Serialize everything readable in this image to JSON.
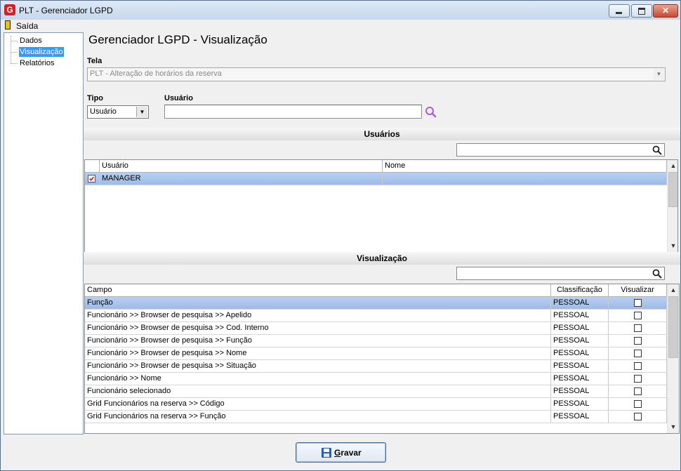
{
  "window": {
    "title": "PLT - Gerenciador LGPD",
    "app_icon_letter": "G",
    "close_symbol": "✕"
  },
  "menu": {
    "exit_label": "Saída"
  },
  "tree": {
    "items": [
      {
        "label": "Dados",
        "selected": false
      },
      {
        "label": "Visualização",
        "selected": true
      },
      {
        "label": "Relatórios",
        "selected": false
      }
    ]
  },
  "page": {
    "title": "Gerenciador LGPD - Visualização",
    "tela_label": "Tela",
    "tela_value": "PLT - Alteração de horários da reserva",
    "tipo_label": "Tipo",
    "tipo_value": "Usuário",
    "usuario_label": "Usuário",
    "usuario_value": ""
  },
  "users_section": {
    "title": "Usuários",
    "filter_value": "",
    "columns": [
      "Usuário",
      "Nome"
    ],
    "rows": [
      {
        "checked": true,
        "usuario": "MANAGER",
        "nome": ""
      }
    ]
  },
  "view_section": {
    "title": "Visualização",
    "filter_value": "",
    "columns": [
      "Campo",
      "Classificação",
      "Visualizar"
    ],
    "rows": [
      {
        "campo": "Função",
        "classificacao": "PESSOAL",
        "visualizar": false
      },
      {
        "campo": "Funcionário >> Browser de pesquisa >> Apelido",
        "classificacao": "PESSOAL",
        "visualizar": false
      },
      {
        "campo": "Funcionário >> Browser de pesquisa >> Cod. Interno",
        "classificacao": "PESSOAL",
        "visualizar": false
      },
      {
        "campo": "Funcionário >> Browser de pesquisa >> Função",
        "classificacao": "PESSOAL",
        "visualizar": false
      },
      {
        "campo": "Funcionário >> Browser de pesquisa >> Nome",
        "classificacao": "PESSOAL",
        "visualizar": false
      },
      {
        "campo": "Funcionário >> Browser de pesquisa >> Situação",
        "classificacao": "PESSOAL",
        "visualizar": false
      },
      {
        "campo": "Funcionário >> Nome",
        "classificacao": "PESSOAL",
        "visualizar": false
      },
      {
        "campo": "Funcionário selecionado",
        "classificacao": "PESSOAL",
        "visualizar": false
      },
      {
        "campo": "Grid Funcionários na reserva >> Código",
        "classificacao": "PESSOAL",
        "visualizar": false
      },
      {
        "campo": "Grid Funcionários na reserva >> Função",
        "classificacao": "PESSOAL",
        "visualizar": false
      }
    ]
  },
  "footer": {
    "save_label": "Gravar"
  },
  "colors": {
    "selection_blue": "#3399ff",
    "row_selected": "#a9c4ec",
    "close_red": "#c74a31",
    "search_purple": "#b05ad6",
    "check_red": "#d01818"
  }
}
